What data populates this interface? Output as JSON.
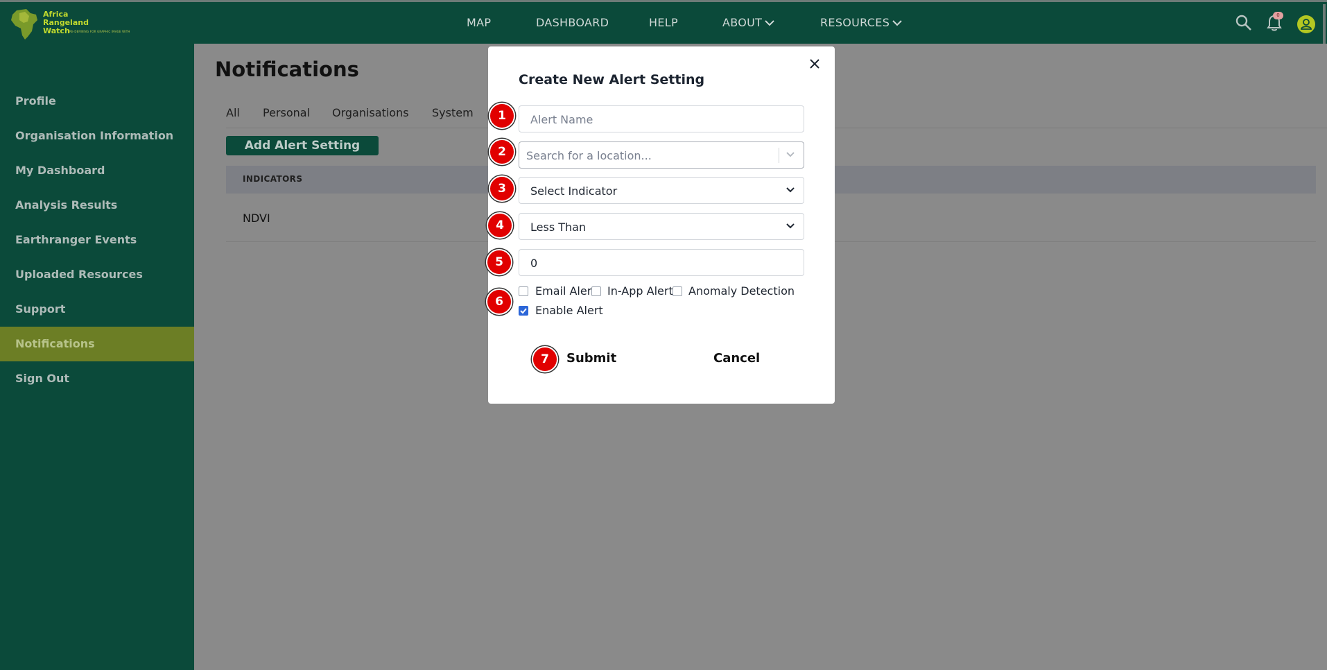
{
  "logo": {
    "line1": "Africa",
    "line2": "Rangeland",
    "line3": "Watch",
    "tagline": "RE-DEFINING FOR GRAPHIC IMAGE WITH"
  },
  "nav": {
    "map": "MAP",
    "dashboard": "DASHBOARD",
    "help": "HELP",
    "about": "ABOUT",
    "resources": "RESOURCES"
  },
  "header": {
    "notification_count": "0"
  },
  "sidebar": {
    "items": [
      {
        "label": "Profile"
      },
      {
        "label": "Organisation Information"
      },
      {
        "label": "My Dashboard"
      },
      {
        "label": "Analysis Results"
      },
      {
        "label": "Earthranger Events"
      },
      {
        "label": "Uploaded Resources"
      },
      {
        "label": "Support"
      },
      {
        "label": "Notifications"
      },
      {
        "label": "Sign Out"
      }
    ]
  },
  "page": {
    "title": "Notifications",
    "tabs": [
      {
        "label": "All"
      },
      {
        "label": "Personal"
      },
      {
        "label": "Organisations"
      },
      {
        "label": "System"
      }
    ],
    "add_button": "Add Alert Setting",
    "table": {
      "header": "INDICATORS",
      "rows": [
        {
          "indicator": "NDVI"
        }
      ]
    }
  },
  "modal": {
    "title": "Create New Alert Setting",
    "alert_name_placeholder": "Alert Name",
    "location_placeholder": "Search for a location...",
    "indicator_value": "Select Indicator",
    "condition_value": "Less Than",
    "threshold_value": "0",
    "checkboxes": {
      "email": "Email Alert",
      "in_app": "In-App Alert",
      "anomaly": "Anomaly Detection",
      "enable": "Enable Alert"
    },
    "submit": "Submit",
    "cancel": "Cancel"
  },
  "markers": [
    "1",
    "2",
    "3",
    "4",
    "5",
    "6",
    "7"
  ],
  "colors": {
    "brand_green": "#0b4a3a",
    "active_sidebar": "#6c7e25",
    "accent_lime": "#b3c722",
    "marker_red": "#e10000",
    "checkbox_blue": "#2c66d8"
  }
}
